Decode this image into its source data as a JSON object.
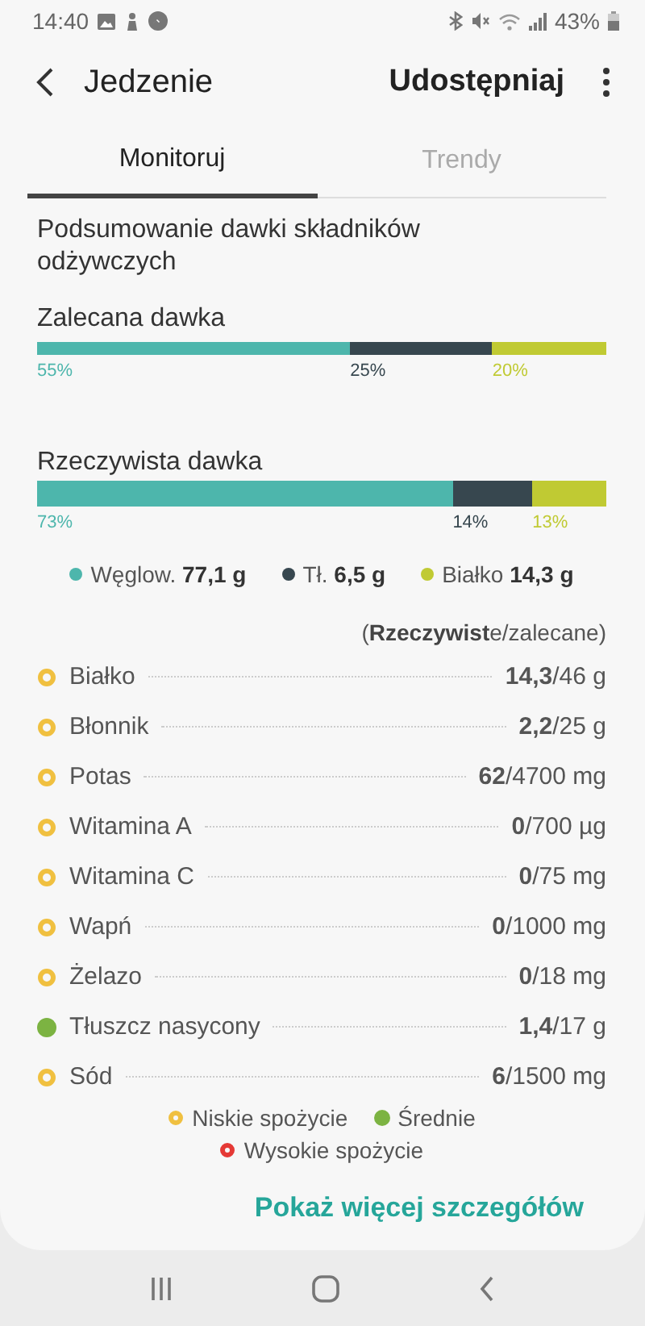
{
  "status_bar": {
    "time": "14:40",
    "battery": "43%"
  },
  "app_bar": {
    "title": "Jedzenie",
    "action": "Udostępniaj"
  },
  "tabs": [
    {
      "label": "Monitoruj",
      "selected": true
    },
    {
      "label": "Trendy",
      "selected": false
    }
  ],
  "summary": {
    "title": "Podsumowanie dawki składników odżywczych",
    "bars": [
      {
        "title": "Zalecana dawka",
        "segments": [
          {
            "label": "55%",
            "color": "#4db6ac",
            "level": 0.55
          },
          {
            "label": "25%",
            "color": "#37474f",
            "level": 0.8
          },
          {
            "label": "20%",
            "color": "#c0ca33"
          }
        ]
      },
      {
        "title": "Rzeczywista dawka",
        "segments": [
          {
            "label": "73%",
            "color": "#4db6ac",
            "level": 0.73
          },
          {
            "label": "14%",
            "color": "#37474f",
            "level": 0.87
          },
          {
            "label": "13%",
            "color": "#c0ca33"
          }
        ]
      }
    ],
    "legend": [
      {
        "name": "Węglow.",
        "value": "77,1 g",
        "color": "#4db6ac"
      },
      {
        "name": "Tł.",
        "value": "6,5 g",
        "color": "#37474f"
      },
      {
        "name": "Białko",
        "value": "14,3 g",
        "color": "#c0ca33"
      }
    ]
  },
  "nutrients": {
    "header": "(**Rzeczywist**e/zalecane)",
    "rows": [
      {
        "name": "Białko",
        "value": "**14,3**/46 g",
        "kind": "low"
      },
      {
        "name": "Błonnik",
        "value": "**2,2**/25 g",
        "kind": "low"
      },
      {
        "name": "Potas",
        "value": "**62**/4700 mg",
        "kind": "low"
      },
      {
        "name": "Witamina A",
        "value": "**0**/700 µg",
        "kind": "low"
      },
      {
        "name": "Witamina C",
        "value": "**0**/75 mg",
        "kind": "low"
      },
      {
        "name": "Wapń",
        "value": "**0**/1000 mg",
        "kind": "low"
      },
      {
        "name": "Żelazo",
        "value": "**0**/18 mg",
        "kind": "low"
      },
      {
        "name": "Tłuszcz nasycony",
        "value": "**1,4**/17 g",
        "kind": "medium"
      },
      {
        "name": "Sód",
        "value": "**6**/1500 mg",
        "kind": "low"
      }
    ],
    "legend": [
      {
        "label": "Niskie spożycie",
        "kind": "low"
      },
      {
        "label": "Średnie",
        "kind": "medium"
      },
      {
        "label": "Wysokie spożycie",
        "kind": "high"
      }
    ]
  },
  "link": "Pokaż więcej szczegółów"
}
